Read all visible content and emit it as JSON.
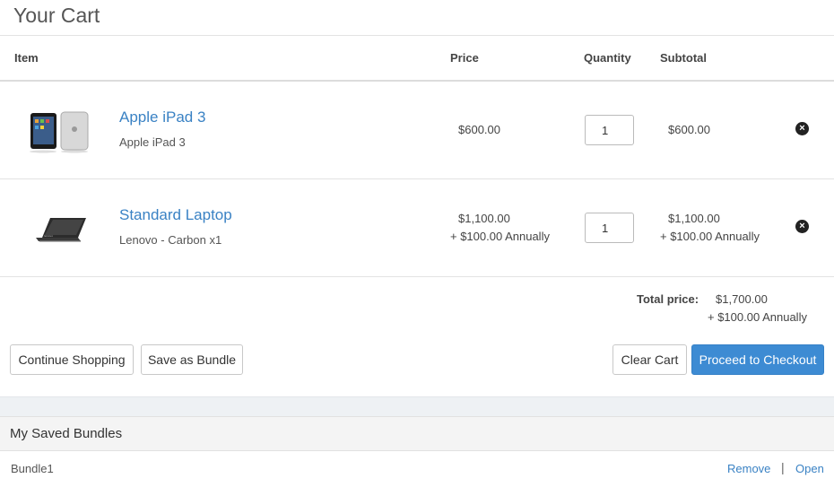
{
  "page": {
    "title": "Your Cart"
  },
  "columns": {
    "item": "Item",
    "price": "Price",
    "quantity": "Quantity",
    "subtotal": "Subtotal"
  },
  "items": [
    {
      "name": "Apple iPad 3",
      "description": "Apple iPad 3",
      "price": "$600.00",
      "price_recurring": "",
      "quantity": "1",
      "subtotal": "$600.00",
      "subtotal_recurring": "",
      "thumbnail_icon": "ipad-thumbnail-icon"
    },
    {
      "name": "Standard Laptop",
      "description": "Lenovo - Carbon x1",
      "price": "$1,100.00",
      "price_recurring": "+ $100.00 Annually",
      "quantity": "1",
      "subtotal": "$1,100.00",
      "subtotal_recurring": "+ $100.00 Annually",
      "thumbnail_icon": "laptop-thumbnail-icon"
    }
  ],
  "totals": {
    "label": "Total price:",
    "value": "$1,700.00",
    "recurring": "+ $100.00 Annually"
  },
  "buttons": {
    "continue_shopping": "Continue Shopping",
    "save_bundle": "Save as Bundle",
    "clear_cart": "Clear Cart",
    "checkout": "Proceed to Checkout"
  },
  "saved_bundles": {
    "title": "My Saved Bundles",
    "items": [
      {
        "name": "Bundle1",
        "remove_label": "Remove",
        "separator": "|",
        "open_label": "Open"
      }
    ]
  },
  "colors": {
    "link": "#3a82c4",
    "primary": "#3d8bd3"
  }
}
